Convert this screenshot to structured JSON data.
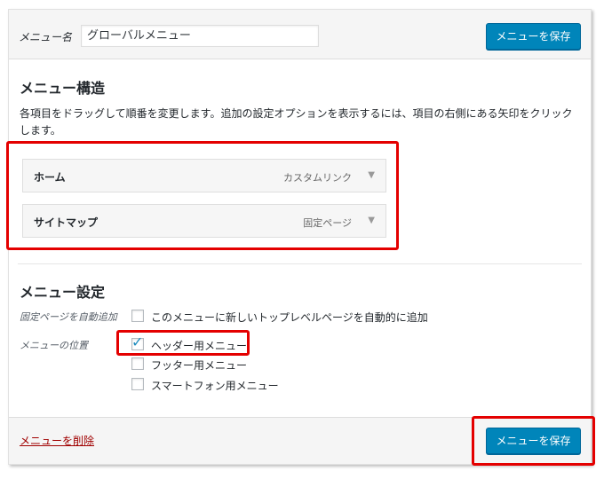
{
  "header": {
    "name_label": "メニュー名",
    "name_value": "グローバルメニュー",
    "save_label": "メニューを保存"
  },
  "structure": {
    "title": "メニュー構造",
    "description": "各項目をドラッグして順番を変更します。追加の設定オプションを表示するには、項目の右側にある矢印をクリックします。",
    "items": [
      {
        "title": "ホーム",
        "type": "カスタムリンク",
        "arrow": "▼"
      },
      {
        "title": "サイトマップ",
        "type": "固定ページ",
        "arrow": "▼"
      }
    ]
  },
  "settings": {
    "title": "メニュー設定",
    "auto_add_label": "固定ページを自動追加",
    "auto_add_option": "このメニューに新しいトップレベルページを自動的に追加",
    "auto_add_checked": false,
    "location_label": "メニューの位置",
    "locations": [
      {
        "label": "ヘッダー用メニュー",
        "checked": true
      },
      {
        "label": "フッター用メニュー",
        "checked": false
      },
      {
        "label": "スマートフォン用メニュー",
        "checked": false
      }
    ]
  },
  "footer": {
    "delete_label": "メニューを削除",
    "save_label": "メニューを保存"
  },
  "colors": {
    "primary_button": "#0085ba",
    "highlight_box": "#e40000",
    "delete_link": "#a00000"
  }
}
